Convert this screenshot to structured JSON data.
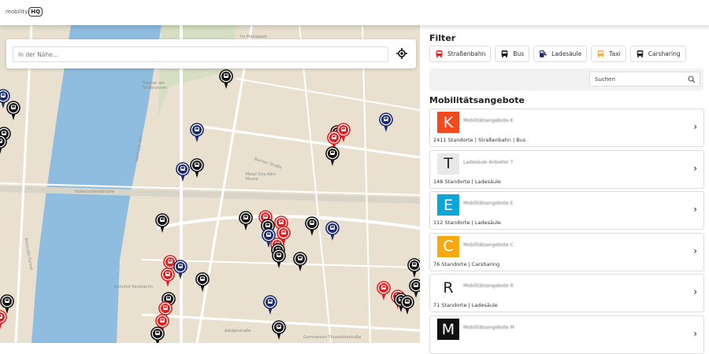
{
  "header": {
    "logo_text": "mobility",
    "logo_mark": "HQ"
  },
  "map": {
    "search_placeholder": "In der Nähe...",
    "labels": [
      "Im Mediapark",
      "Theater am Tanzbrunnen",
      "Hohenzollernbrücke",
      "Motel One Köln-Messe",
      "Barmer Straße",
      "Kennedy-Ufer",
      "Rheinufer-Tunnel",
      "Bahnhof Konstantin",
      "Adolphstraße",
      "Gymnasium Thusneldastraße"
    ]
  },
  "filter": {
    "title": "Filter",
    "chips": [
      {
        "label": "Straßenbahn",
        "icon": "tram-icon",
        "color": "#e02020"
      },
      {
        "label": "Bus",
        "icon": "bus-icon",
        "color": "#111111"
      },
      {
        "label": "Ladesäule",
        "icon": "charging-station-icon",
        "color": "#1a2a6c"
      },
      {
        "label": "Taxi",
        "icon": "taxi-icon",
        "color": "#f5b043"
      },
      {
        "label": "Carsharing",
        "icon": "car-icon",
        "color": "#222222"
      }
    ],
    "search_placeholder": "Suchen"
  },
  "offers": {
    "title": "Mobilitätsangebote",
    "items": [
      {
        "letter": "K",
        "name": "Mobilitätsangebote K",
        "meta": "2411 Standorte | Straßenbahn | Bus",
        "color": "#f24a1d",
        "fg": "#ffffff"
      },
      {
        "letter": "T",
        "name": "Ladesäule Anbieter T",
        "meta": "148 Standorte | Ladesäule",
        "color": "#e8e8e8",
        "fg": "#222222"
      },
      {
        "letter": "E",
        "name": "Mobilitätsangebote E",
        "meta": "112 Standorte | Ladesäule",
        "color": "#0ea5d9",
        "fg": "#ffffff"
      },
      {
        "letter": "C",
        "name": "Mobilitätsangebote C",
        "meta": "76 Standorte | Carsharing",
        "color": "#f7a912",
        "fg": "#ffffff"
      },
      {
        "letter": "R",
        "name": "Mobilitätsangebote R",
        "meta": "71 Standorte | Ladesäule",
        "color": "#ffffff",
        "fg": "#222222"
      },
      {
        "letter": "M",
        "name": "Mobilitätsangebote M",
        "meta": "",
        "color": "#111111",
        "fg": "#ffffff"
      }
    ]
  },
  "colors": {
    "tram": "#e02020",
    "bus": "#111111",
    "charge": "#1a2a6c",
    "water": "#8fbde0",
    "land": "#e9e0cf"
  }
}
